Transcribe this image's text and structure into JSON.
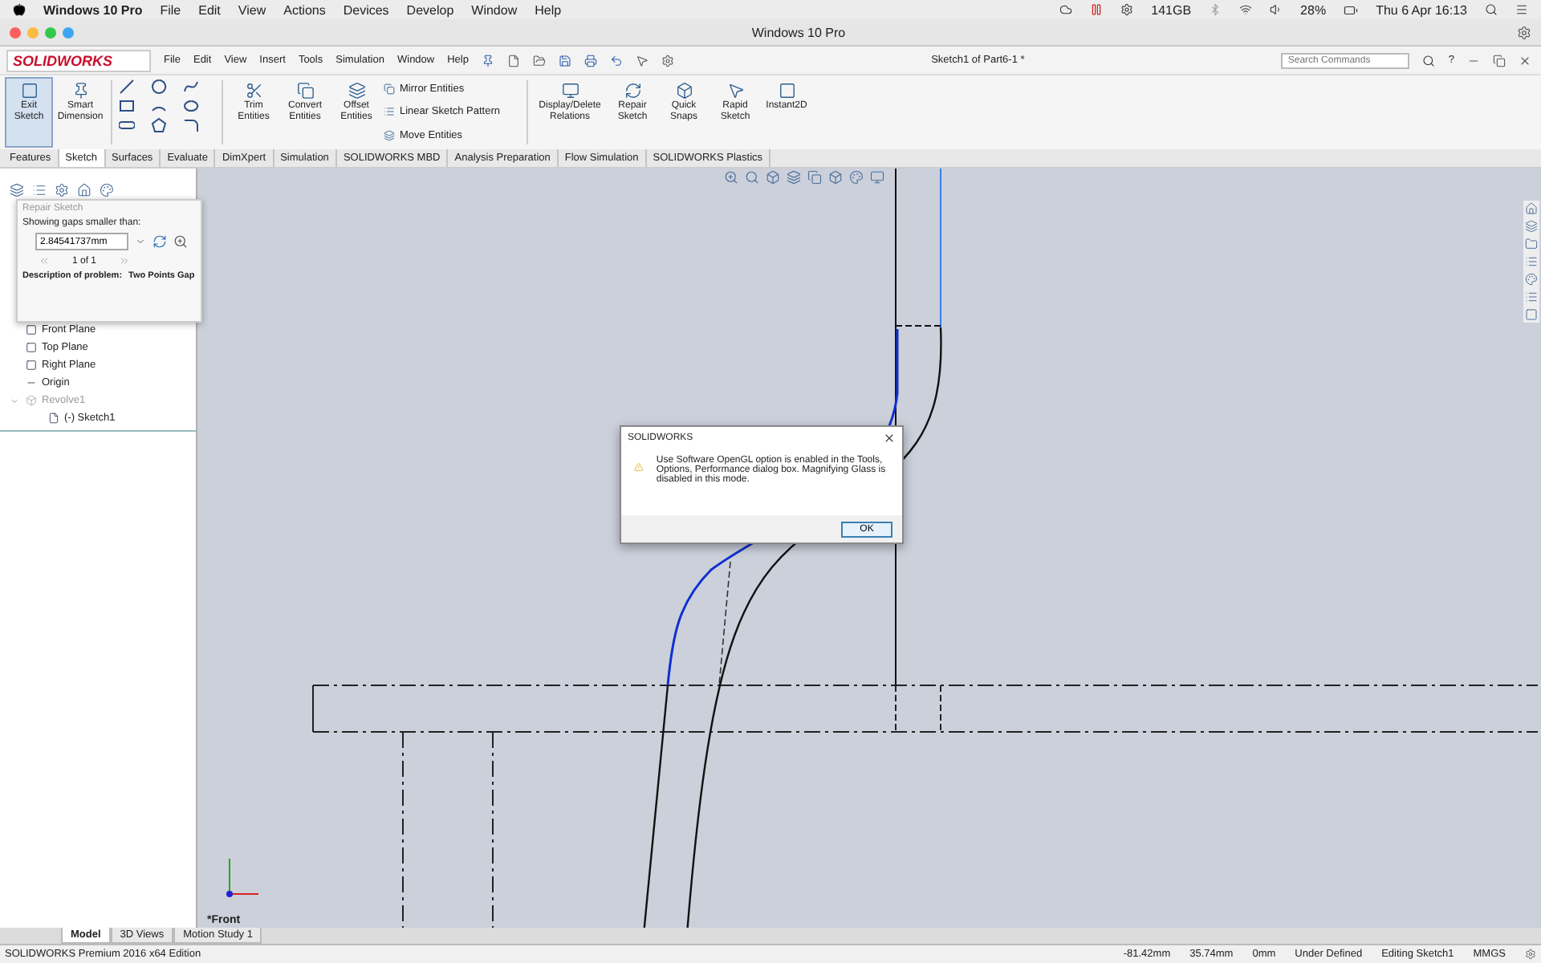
{
  "menubar": {
    "app": "Windows 10 Pro",
    "menus": [
      "File",
      "Edit",
      "View",
      "Actions",
      "Devices",
      "Develop",
      "Window",
      "Help"
    ],
    "storage": "141GB",
    "battery": "28%",
    "clock": "Thu 6 Apr 16:13"
  },
  "window": {
    "title": "Windows 10 Pro"
  },
  "app": {
    "logo": "SOLIDWORKS",
    "menus": [
      "File",
      "Edit",
      "View",
      "Insert",
      "Tools",
      "Simulation",
      "Window",
      "Help"
    ],
    "document_title": "Sketch1 of Part6-1 *",
    "search": {
      "placeholder": "Search Commands"
    },
    "help": "?"
  },
  "ribbon": [
    {
      "kind": "large",
      "label": "Exit Sketch",
      "selected": true
    },
    {
      "kind": "large",
      "label": "Smart Dimension",
      "selected": false
    },
    {
      "kind": "tools"
    },
    {
      "kind": "large",
      "label": "Trim Entities",
      "selected": false
    },
    {
      "kind": "large",
      "label": "Convert Entities",
      "selected": false
    },
    {
      "kind": "large",
      "label": "Offset Entities",
      "selected": false
    },
    {
      "kind": "list",
      "items": [
        "Mirror Entities",
        "Linear Sketch Pattern",
        "Move Entities"
      ]
    },
    {
      "kind": "large",
      "label": "Display/Delete Relations",
      "selected": false
    },
    {
      "kind": "large",
      "label": "Repair Sketch",
      "selected": false
    },
    {
      "kind": "large",
      "label": "Quick Snaps",
      "selected": false
    },
    {
      "kind": "large",
      "label": "Rapid Sketch",
      "selected": false
    },
    {
      "kind": "large",
      "label": "Instant2D",
      "selected": false
    }
  ],
  "tabs": [
    {
      "label": "Features",
      "selected": false
    },
    {
      "label": "Sketch",
      "selected": true
    },
    {
      "label": "Surfaces",
      "selected": false
    },
    {
      "label": "Evaluate",
      "selected": false
    },
    {
      "label": "DimXpert",
      "selected": false
    },
    {
      "label": "Simulation",
      "selected": false
    },
    {
      "label": "SOLIDWORKS MBD",
      "selected": false
    },
    {
      "label": "Analysis Preparation",
      "selected": false
    },
    {
      "label": "Flow Simulation",
      "selected": false
    },
    {
      "label": "SOLIDWORKS Plastics",
      "selected": false
    }
  ],
  "feature_tree": [
    {
      "kind": "plane",
      "label": "Front Plane",
      "disabled": false
    },
    {
      "kind": "plane",
      "label": "Top Plane",
      "disabled": false
    },
    {
      "kind": "plane",
      "label": "Right Plane",
      "disabled": false
    },
    {
      "kind": "origin",
      "label": "Origin",
      "disabled": false
    },
    {
      "kind": "feature",
      "label": "Revolve1",
      "disabled": true,
      "expanded": true,
      "children": [
        {
          "kind": "sketch",
          "label": "(-) Sketch1",
          "disabled": false
        }
      ]
    }
  ],
  "repair_sketch": {
    "title": "Repair Sketch",
    "prompt": "Showing gaps smaller than:",
    "gap_value": "2.84541737mm",
    "counter": "1 of 1",
    "description_label": "Description of problem:",
    "description_value": "Two Points Gap"
  },
  "viewport": {
    "view_label": "*Front"
  },
  "dialog": {
    "title": "SOLIDWORKS",
    "message": "Use Software OpenGL option is enabled in the Tools, Options, Performance dialog box. Magnifying Glass is disabled in this mode.",
    "buttons": [
      "OK"
    ]
  },
  "bottom_tabs": [
    {
      "label": "Model",
      "selected": true
    },
    {
      "label": "3D Views",
      "selected": false
    },
    {
      "label": "Motion Study 1",
      "selected": false
    }
  ],
  "status_bar": {
    "edition": "SOLIDWORKS Premium 2016 x64 Edition",
    "x": "-81.42mm",
    "y": "35.74mm",
    "z": "0mm",
    "state": "Under Defined",
    "mode": "Editing Sketch1",
    "units": "MMGS"
  }
}
